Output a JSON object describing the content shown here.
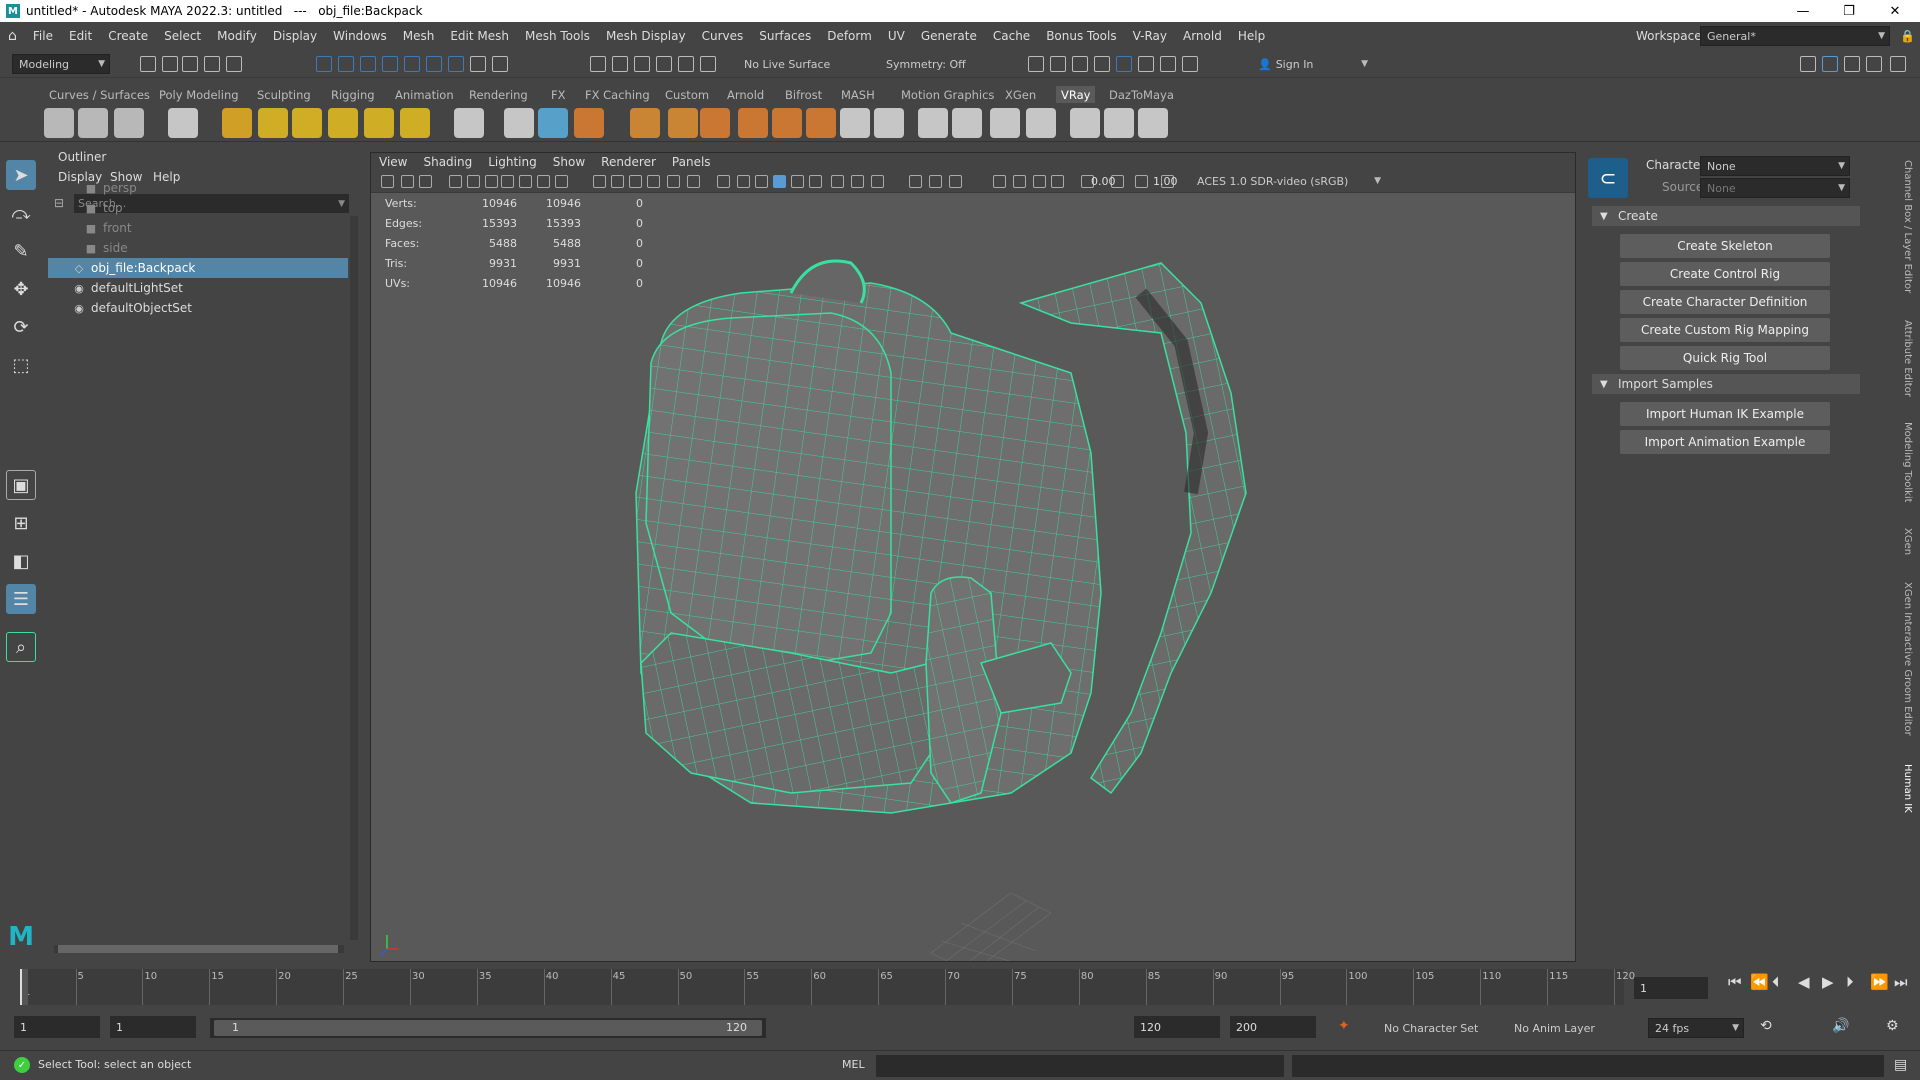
{
  "window": {
    "title": "untitled* - Autodesk MAYA 2022.3: untitled   ---   obj_file:Backpack",
    "logo": "M",
    "controls": [
      "—",
      "❐",
      "✕"
    ]
  },
  "menubar": {
    "items": [
      "File",
      "Edit",
      "Create",
      "Select",
      "Modify",
      "Display",
      "Windows",
      "Mesh",
      "Edit Mesh",
      "Mesh Tools",
      "Mesh Display",
      "Curves",
      "Surfaces",
      "Deform",
      "UV",
      "Generate",
      "Cache",
      "Bonus Tools",
      "V-Ray",
      "Arnold",
      "Help"
    ],
    "workspace_label": "Workspace:",
    "workspace_value": "General*"
  },
  "statusline": {
    "menuset": "Modeling",
    "live_surface": "No Live Surface",
    "symmetry": "Symmetry: Off",
    "signin": "Sign In"
  },
  "shelf": {
    "tabs": [
      "Curves / Surfaces",
      "Poly Modeling",
      "Sculpting",
      "Rigging",
      "Animation",
      "Rendering",
      "FX",
      "FX Caching",
      "Custom",
      "Arnold",
      "Bifrost",
      "MASH",
      "Motion Graphics",
      "XGen",
      "VRay",
      "DazToMaya"
    ],
    "active_tab": "VRay"
  },
  "outliner": {
    "title": "Outliner",
    "menu": [
      "Display",
      "Show",
      "Help"
    ],
    "search_placeholder": "Search...",
    "items": [
      {
        "label": "persp",
        "dim": true
      },
      {
        "label": "top",
        "dim": true
      },
      {
        "label": "front",
        "dim": true
      },
      {
        "label": "side",
        "dim": true
      },
      {
        "label": "obj_file:Backpack",
        "selected": true
      },
      {
        "label": "defaultLightSet"
      },
      {
        "label": "defaultObjectSet"
      }
    ]
  },
  "viewport": {
    "menu": [
      "View",
      "Shading",
      "Lighting",
      "Show",
      "Renderer",
      "Panels"
    ],
    "exposure": "0.00",
    "gamma": "1.00",
    "color_space": "ACES 1.0 SDR-video (sRGB)",
    "hud": [
      {
        "label": "Verts:",
        "a": "10946",
        "b": "10946",
        "c": "0"
      },
      {
        "label": "Edges:",
        "a": "15393",
        "b": "15393",
        "c": "0"
      },
      {
        "label": "Faces:",
        "a": "5488",
        "b": "5488",
        "c": "0"
      },
      {
        "label": "Tris:",
        "a": "9931",
        "b": "9931",
        "c": "0"
      },
      {
        "label": "UVs:",
        "a": "10946",
        "b": "10946",
        "c": "0"
      }
    ],
    "wire_color": "#39e0a0"
  },
  "humanik": {
    "character_label": "Character:",
    "character_value": "None",
    "source_label": "Source:",
    "source_value": "None",
    "create_section": "Create",
    "create_buttons": [
      "Create Skeleton",
      "Create Control Rig",
      "Create Character Definition",
      "Create Custom Rig Mapping",
      "Quick Rig Tool"
    ],
    "import_section": "Import Samples",
    "import_buttons": [
      "Import Human IK Example",
      "Import Animation Example"
    ]
  },
  "side_tabs": [
    "Channel Box / Layer Editor",
    "Attribute Editor",
    "Modeling Toolkit",
    "XGen",
    "XGen Interactive Groom Editor",
    "Human IK"
  ],
  "timeline": {
    "ticks": [
      "1",
      "5",
      "10",
      "15",
      "20",
      "25",
      "30",
      "35",
      "40",
      "45",
      "50",
      "55",
      "60",
      "65",
      "70",
      "75",
      "80",
      "85",
      "90",
      "95",
      "100",
      "105",
      "110",
      "115",
      "120"
    ],
    "current_frame": "1",
    "range_start": "1",
    "range_start2": "1",
    "range_inner_start": "1",
    "range_inner_end": "120",
    "range_end": "120",
    "range_end2": "200",
    "character_set": "No Character Set",
    "anim_layer": "No Anim Layer",
    "fps": "24 fps"
  },
  "commandline": {
    "help_text": "Select Tool: select an object",
    "lang": "MEL"
  }
}
